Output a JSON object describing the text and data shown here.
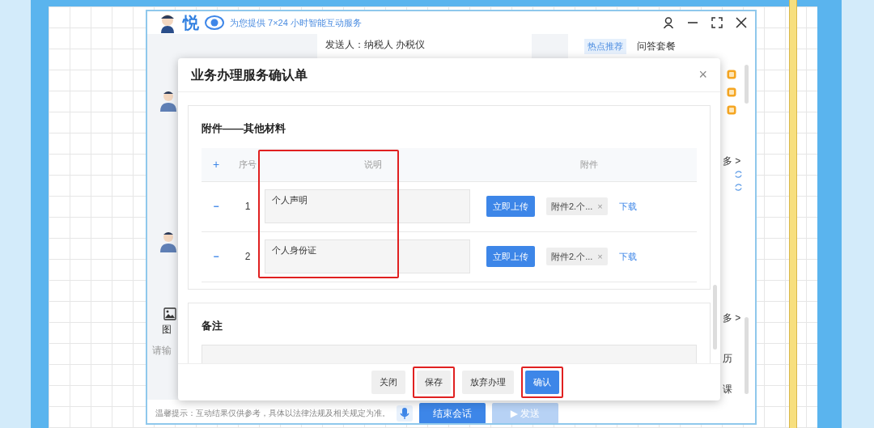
{
  "app": {
    "brand": "悦",
    "tagline": "为您提供 7×24 小时智能互动服务"
  },
  "background": {
    "message_line": "发送人：纳税人 办税仪",
    "recommend_tag": "热点推荐",
    "recommend_label": "问答套餐",
    "more_links": [
      "多 >",
      "多 >"
    ],
    "image_label": "图",
    "input_placeholder": "请输",
    "side_fragments": [
      "历",
      "课"
    ],
    "tip": "温馨提示：互动结果仅供参考，具体以法律法规及相关规定为准。",
    "end_button": "结束会话",
    "send_button": {
      "icon": "▶",
      "label": "发送",
      "disabled": true
    }
  },
  "dialog": {
    "title": "业务办理服务确认单",
    "close": "×",
    "sections": [
      {
        "kind": "table",
        "title": "附件——其他材料",
        "columns": [
          {
            "label": "+",
            "highlighted": false
          },
          {
            "label": "序号",
            "highlighted": false
          },
          {
            "label": "说明",
            "highlighted": true
          },
          {
            "label": "附件",
            "highlighted": false
          }
        ],
        "rows": [
          {
            "remove": "−",
            "index": "1",
            "description": "个人声明",
            "upload_button": "立即上传",
            "file": "附件2.个...",
            "file_remove": "×",
            "download": "下载"
          },
          {
            "remove": "−",
            "index": "2",
            "description": "个人身份证",
            "upload_button": "立即上传",
            "file": "附件2.个...",
            "file_remove": "×",
            "download": "下载"
          }
        ]
      },
      {
        "kind": "note",
        "title": "备注"
      }
    ],
    "buttons": [
      {
        "label": "关闭",
        "kind": "default",
        "highlighted": false
      },
      {
        "label": "保存",
        "kind": "default",
        "highlighted": true
      },
      {
        "label": "放弃办理",
        "kind": "default",
        "highlighted": false
      },
      {
        "label": "确认",
        "kind": "primary",
        "highlighted": true
      }
    ]
  }
}
